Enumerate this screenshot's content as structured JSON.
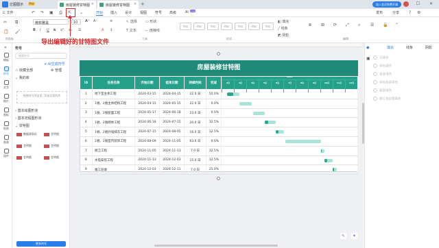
{
  "titlebar": {
    "app_name": "亿图图示",
    "pro_badge": "Pro",
    "tabs": [
      {
        "label": "房屋装修甘特图"
      },
      {
        "label": "房屋装修甘特图"
      }
    ],
    "plus": "+",
    "member_button": "加入会员免费开通",
    "window_controls": "– ☐ ✕"
  },
  "menu": {
    "file": "三 文件",
    "items": [
      "开始",
      "插入",
      "设计",
      "视图",
      "符号",
      "高级",
      "AI"
    ],
    "active": "开始",
    "ai_badge": "new",
    "right": [
      "发布",
      "分享"
    ]
  },
  "ribbon": {
    "font_name": "微软雅黑",
    "font_size": "10",
    "select_label": "选择",
    "shape_label": "形状",
    "text_label": "文本",
    "connector_label": "连接线",
    "tools_label": "工具",
    "style_boxes": [
      "Abc",
      "Abc",
      "Abc",
      "Abc",
      "Abc",
      "Abc",
      "Abc"
    ],
    "style_label": "样式",
    "fill_label": "填充",
    "line_label": "线条",
    "shadow_label": "阴影",
    "sections": [
      "剪贴板",
      "字体",
      "工具",
      "样式",
      "编辑"
    ]
  },
  "annotation": "导出编辑好的甘特图文件",
  "rail": {
    "items": [
      "模板",
      "符号",
      "文字",
      "图片",
      "图标",
      "贴纸",
      "图表",
      "组件"
    ],
    "active": "符号"
  },
  "symbols_panel": {
    "title": "符号",
    "search_placeholder": "搜索符号",
    "ai_label": "AI生成符号",
    "favorites": "收藏全部",
    "manage": "管理",
    "my_library": "我的库",
    "drop_hint": "拖拽符号到这里, 添加至我的库",
    "basic_shapes": "基本绘图形状",
    "basic_flow": "基本流程图形状",
    "gantt_section": "甘特图",
    "thumbs": [
      "数据源条形",
      "甘特图",
      "甘特图",
      "甘特图",
      "甘特图",
      "甘特图"
    ],
    "more_button": "更多符号"
  },
  "gantt": {
    "title": "房屋装修甘特图",
    "headers": [
      "ID",
      "任务名称",
      "开始日期",
      "结束日期",
      "持续时间",
      "完成"
    ],
    "timeline_year": "2024",
    "months": [
      "2月",
      "3月",
      "4月",
      "5月",
      "6月",
      "7月",
      "8月",
      "9月",
      "10月",
      "11月",
      "12月"
    ],
    "rows": [
      {
        "id": "1",
        "task": "地下室主体工程",
        "start": "2024-03-15",
        "end": "2024-04-15",
        "dur": "22.0 日",
        "pct": "50.0%",
        "done": 0.5,
        "from": 0.04,
        "to": 0.13
      },
      {
        "id": "2",
        "task": "1號、2號主体结构工程",
        "start": "2024-04-15",
        "end": "2024-05-15",
        "dur": "22.0 日",
        "pct": "0.0%",
        "done": 0.0,
        "from": 0.13,
        "to": 0.22
      },
      {
        "id": "3",
        "task": "1號、2號屋面工程",
        "start": "2024-05-17",
        "end": "2024-06-18",
        "dur": "23.0 日",
        "pct": "0.0%",
        "done": 0.0,
        "from": 0.23,
        "to": 0.32
      },
      {
        "id": "4",
        "task": "1號、2號砌体工程",
        "start": "2024-06-18",
        "end": "2024-07-15",
        "dur": "20.0 日",
        "pct": "12.5%",
        "done": 0.125,
        "from": 0.32,
        "to": 0.4
      },
      {
        "id": "5",
        "task": "1號、2號外墙抹灰工程",
        "start": "2024-07-15",
        "end": "2024-08-05",
        "dur": "16.0 日",
        "pct": "12.5%",
        "done": 0.125,
        "from": 0.4,
        "to": 0.46
      },
      {
        "id": "6",
        "task": "1號、2號室内装饰工程",
        "start": "2024-08-09",
        "end": "2024-11-05",
        "dur": "63.0 日",
        "pct": "0.0%",
        "done": 0.0,
        "from": 0.47,
        "to": 0.73
      },
      {
        "id": "7",
        "task": "厨卫工程",
        "start": "2024-11-05",
        "end": "2024-11-13",
        "dur": "7.0 日",
        "pct": "12.5%",
        "done": 0.125,
        "from": 0.73,
        "to": 0.76
      },
      {
        "id": "8",
        "task": "水电安装工程",
        "start": "2024-11-13",
        "end": "2024-12-03",
        "dur": "15.0 日",
        "pct": "12.5%",
        "done": 0.125,
        "from": 0.76,
        "to": 0.82
      },
      {
        "id": "9",
        "task": "竣工验收",
        "start": "2024-12-03",
        "end": "2024-12-11",
        "dur": "7.0 日",
        "pct": "25.0%",
        "done": 0.25,
        "from": 0.82,
        "to": 0.85
      }
    ]
  },
  "right_panel": {
    "tabs": [
      "填充",
      "线条",
      "阴影"
    ],
    "active": "填充",
    "options": [
      "无填充",
      "单色填充",
      "渐变填充",
      "单色渐变填充",
      "图案填充",
      "图片或纹理填充"
    ]
  },
  "colors": {
    "accent": "#2b7de9",
    "gantt_header": "#1e8a77",
    "bar_done": "#22a98c",
    "bar_rest": "#a8e4d7",
    "annotation": "#e02424"
  }
}
